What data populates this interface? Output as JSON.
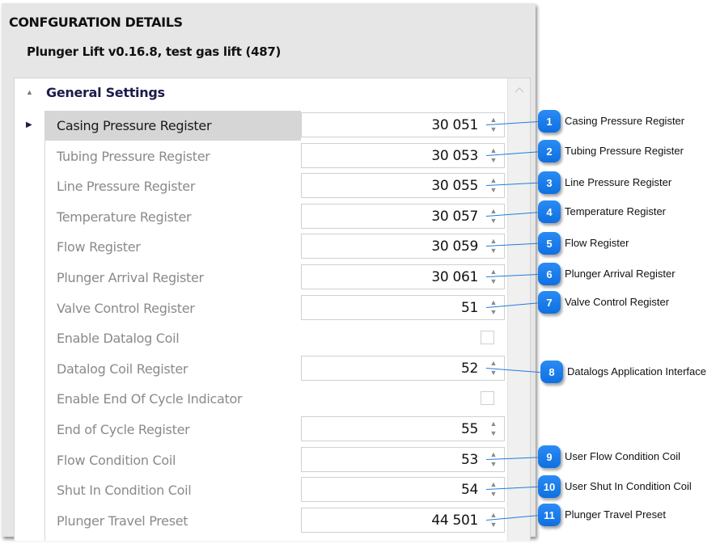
{
  "panel": {
    "title": "CONFGURATION DETAILS",
    "subtitle": "Plunger Lift v0.16.8, test gas lift (487)"
  },
  "group": {
    "label": "General Settings",
    "expanded": true
  },
  "rows": [
    {
      "label": "Casing Pressure Register",
      "type": "spin",
      "value": "30 051",
      "selected": true
    },
    {
      "label": "Tubing Pressure Register",
      "type": "spin",
      "value": "30 053"
    },
    {
      "label": "Line Pressure Register",
      "type": "spin",
      "value": "30 055"
    },
    {
      "label": "Temperature Register",
      "type": "spin",
      "value": "30 057"
    },
    {
      "label": "Flow Register",
      "type": "spin",
      "value": "30 059"
    },
    {
      "label": "Plunger Arrival Register",
      "type": "spin",
      "value": "30 061"
    },
    {
      "label": "Valve Control Register",
      "type": "spin",
      "value": "51"
    },
    {
      "label": "Enable Datalog Coil",
      "type": "checkbox",
      "checked": false
    },
    {
      "label": "Datalog Coil Register",
      "type": "spin",
      "value": "52"
    },
    {
      "label": "Enable End Of Cycle Indicator",
      "type": "checkbox",
      "checked": false
    },
    {
      "label": "End of Cycle Register",
      "type": "spin",
      "value": "55"
    },
    {
      "label": "Flow Condition Coil",
      "type": "spin",
      "value": "53"
    },
    {
      "label": "Shut In Condition Coil",
      "type": "spin",
      "value": "54"
    },
    {
      "label": "Plunger Travel Preset",
      "type": "spin",
      "value": "44 501"
    }
  ],
  "callouts": [
    {
      "number": "1",
      "text": "Casing Pressure Register",
      "row": 0
    },
    {
      "number": "2",
      "text": "Tubing Pressure Register",
      "row": 1
    },
    {
      "number": "3",
      "text": "Line Pressure Register",
      "row": 2
    },
    {
      "number": "4",
      "text": "Temperature Register",
      "row": 3
    },
    {
      "number": "5",
      "text": "Flow Register",
      "row": 4
    },
    {
      "number": "6",
      "text": "Plunger Arrival Register",
      "row": 5
    },
    {
      "number": "7",
      "text": "Valve Control Register",
      "row": 6
    },
    {
      "number": "8",
      "text": "Datalogs Application Interface",
      "row": 8
    },
    {
      "number": "9",
      "text": "User Flow Condition Coil",
      "row": 11
    },
    {
      "number": "10",
      "text": "User Shut In Condition Coil",
      "row": 12
    },
    {
      "number": "11",
      "text": "Plunger Travel Preset",
      "row": 13
    }
  ],
  "icons": {
    "group_toggle": "▲",
    "row_indicator": "▶",
    "spin_up": "▲",
    "spin_down": "▼",
    "scroll_up": "^"
  },
  "colors": {
    "callout_accent": "#1e7be0",
    "group_label": "#1c1c4a"
  }
}
